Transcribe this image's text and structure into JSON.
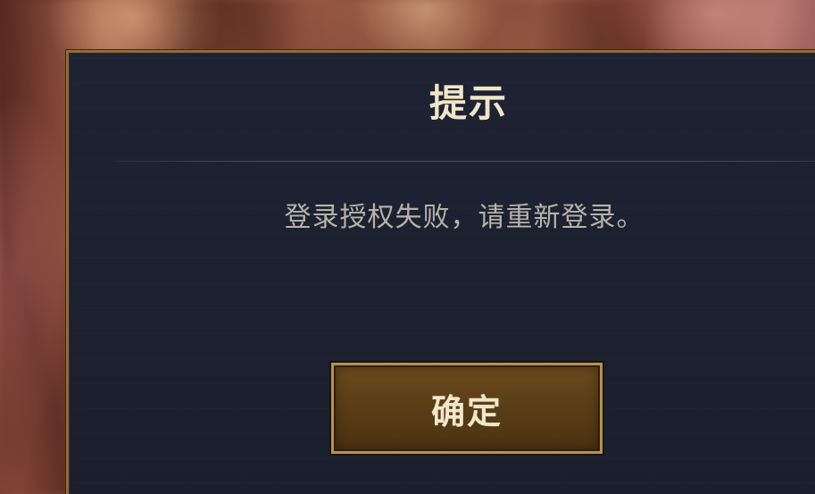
{
  "dialog": {
    "title": "提示",
    "message": "登录授权失败，请重新登录。",
    "confirm_label": "确定"
  },
  "colors": {
    "dialog_background": "#1e2333",
    "dialog_border": "#8c6d3c",
    "title_text": "#f0e6c8",
    "message_text": "#b7b3aa",
    "button_fill": "#5a3d16",
    "button_border": "#b8924a"
  }
}
